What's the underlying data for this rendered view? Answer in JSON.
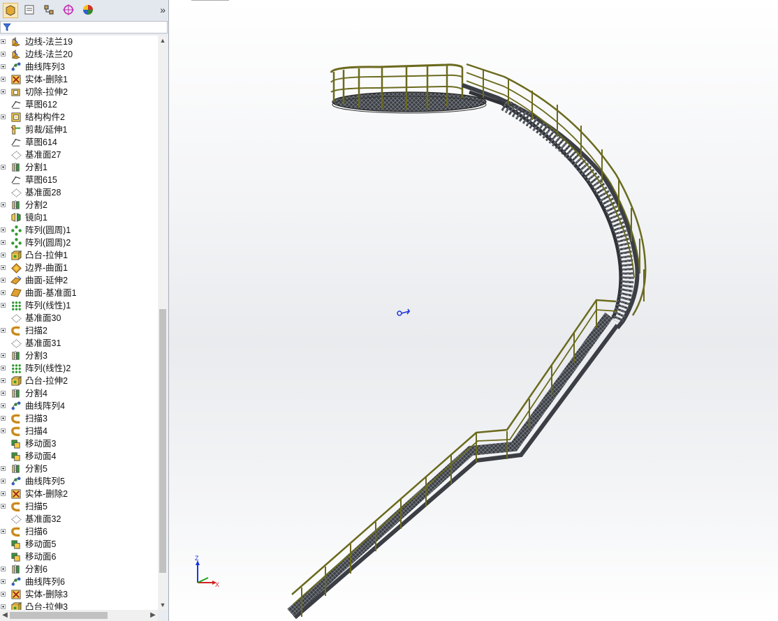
{
  "manager_tabs": [
    {
      "name": "feature-manager-tab",
      "color": "#e6a92f",
      "active": true
    },
    {
      "name": "property-manager-tab",
      "color": "#9aa0a8",
      "active": false
    },
    {
      "name": "configuration-manager-tab",
      "color": "#c8a050",
      "active": false
    },
    {
      "name": "dimxpert-tab",
      "color": "#c02bb0",
      "active": false
    },
    {
      "name": "display-manager-tab",
      "color": "#d03030",
      "active": false
    }
  ],
  "expand_more_glyph": "»",
  "tree_items": [
    {
      "label": "边线-法兰19",
      "icon": "edge-flange-icon",
      "expandable": true
    },
    {
      "label": "边线-法兰20",
      "icon": "edge-flange-icon",
      "expandable": true
    },
    {
      "label": "曲线阵列3",
      "icon": "curve-pattern-icon",
      "expandable": true
    },
    {
      "label": "实体-删除1",
      "icon": "delete-body-icon",
      "expandable": true
    },
    {
      "label": "切除-拉伸2",
      "icon": "extrude-cut-icon",
      "expandable": true
    },
    {
      "label": "草图612",
      "icon": "sketch-icon",
      "expandable": false
    },
    {
      "label": "结构构件2",
      "icon": "structural-member-icon",
      "expandable": true
    },
    {
      "label": "剪裁/延伸1",
      "icon": "trim-extend-icon",
      "expandable": false
    },
    {
      "label": "草图614",
      "icon": "sketch-icon",
      "expandable": false
    },
    {
      "label": "基准面27",
      "icon": "plane-icon",
      "expandable": false
    },
    {
      "label": "分割1",
      "icon": "split-icon",
      "expandable": true
    },
    {
      "label": "草图615",
      "icon": "sketch-icon",
      "expandable": false
    },
    {
      "label": "基准面28",
      "icon": "plane-icon",
      "expandable": false
    },
    {
      "label": "分割2",
      "icon": "split-icon",
      "expandable": true
    },
    {
      "label": "镜向1",
      "icon": "mirror-icon",
      "expandable": false
    },
    {
      "label": "阵列(圆周)1",
      "icon": "circular-pattern-icon",
      "expandable": true
    },
    {
      "label": "阵列(圆周)2",
      "icon": "circular-pattern-icon",
      "expandable": true
    },
    {
      "label": "凸台-拉伸1",
      "icon": "boss-extrude-icon",
      "expandable": true
    },
    {
      "label": "边界-曲面1",
      "icon": "boundary-surface-icon",
      "expandable": true
    },
    {
      "label": "曲面-延伸2",
      "icon": "extend-surface-icon",
      "expandable": true
    },
    {
      "label": "曲面-基准面1",
      "icon": "planar-surface-icon",
      "expandable": true
    },
    {
      "label": "阵列(线性)1",
      "icon": "linear-pattern-icon",
      "expandable": true
    },
    {
      "label": "基准面30",
      "icon": "plane-icon",
      "expandable": false
    },
    {
      "label": "扫描2",
      "icon": "sweep-icon",
      "expandable": true
    },
    {
      "label": "基准面31",
      "icon": "plane-icon",
      "expandable": false
    },
    {
      "label": "分割3",
      "icon": "split-icon",
      "expandable": true
    },
    {
      "label": "阵列(线性)2",
      "icon": "linear-pattern-icon",
      "expandable": true
    },
    {
      "label": "凸台-拉伸2",
      "icon": "boss-extrude-icon",
      "expandable": true
    },
    {
      "label": "分割4",
      "icon": "split-icon",
      "expandable": true
    },
    {
      "label": "曲线阵列4",
      "icon": "curve-pattern-icon",
      "expandable": true
    },
    {
      "label": "扫描3",
      "icon": "sweep-icon",
      "expandable": true
    },
    {
      "label": "扫描4",
      "icon": "sweep-icon",
      "expandable": true
    },
    {
      "label": "移动面3",
      "icon": "move-face-icon",
      "expandable": false
    },
    {
      "label": "移动面4",
      "icon": "move-face-icon",
      "expandable": false
    },
    {
      "label": "分割5",
      "icon": "split-icon",
      "expandable": true
    },
    {
      "label": "曲线阵列5",
      "icon": "curve-pattern-icon",
      "expandable": true
    },
    {
      "label": "实体-删除2",
      "icon": "delete-body-icon",
      "expandable": true
    },
    {
      "label": "扫描5",
      "icon": "sweep-icon",
      "expandable": true
    },
    {
      "label": "基准面32",
      "icon": "plane-icon",
      "expandable": false
    },
    {
      "label": "扫描6",
      "icon": "sweep-icon",
      "expandable": true
    },
    {
      "label": "移动面5",
      "icon": "move-face-icon",
      "expandable": false
    },
    {
      "label": "移动面6",
      "icon": "move-face-icon",
      "expandable": false
    },
    {
      "label": "分割6",
      "icon": "split-icon",
      "expandable": true
    },
    {
      "label": "曲线阵列6",
      "icon": "curve-pattern-icon",
      "expandable": true
    },
    {
      "label": "实体-删除3",
      "icon": "delete-body-icon",
      "expandable": true
    },
    {
      "label": "凸台-拉伸3",
      "icon": "boss-extrude-icon",
      "expandable": true
    }
  ],
  "triad": {
    "x_label": "X",
    "y_label": "Y",
    "z_label": "Z"
  },
  "colors": {
    "rail": "#6b6a1e",
    "rail_hi": "#c9c36a",
    "steel": "#555a60",
    "accent": "#1d33e0"
  }
}
